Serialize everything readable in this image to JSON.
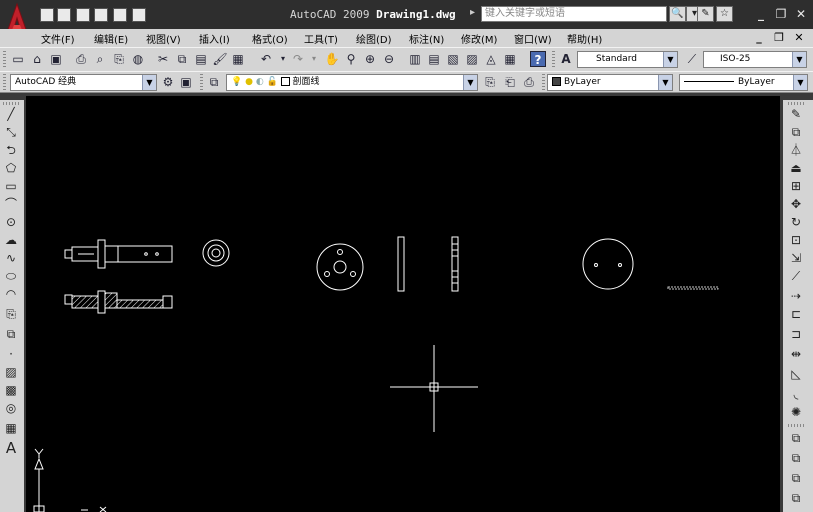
{
  "titlebar": {
    "app_name": "AutoCAD 2009",
    "file_name": "Drawing1.dwg",
    "search_placeholder": "键入关键字或短语",
    "search_arrow": "▸",
    "minimize": "_",
    "restore": "❐",
    "close": "✕"
  },
  "menubar": {
    "items": [
      "文件(F)",
      "编辑(E)",
      "视图(V)",
      "插入(I)",
      "格式(O)",
      "工具(T)",
      "绘图(D)",
      "标注(N)",
      "修改(M)",
      "窗口(W)",
      "帮助(H)"
    ],
    "doc_minimize": "_",
    "doc_restore": "❐",
    "doc_close": "✕"
  },
  "toolbar1": {
    "text_style": "Standard",
    "dim_style": "ISO-25"
  },
  "toolbar2": {
    "workspace": "AutoCAD 经典",
    "layer": "剖面线",
    "color": "ByLayer",
    "linetype": "ByLayer"
  },
  "ucs": {
    "y_label": "Y",
    "x_label": "X"
  },
  "colors": {
    "canvas": "#000000",
    "toolbar": "#d4d4d4",
    "titlebar": "#2e2e2e",
    "logo": "#c0202a",
    "drawing_lines": "#ffffff",
    "dashed_line": "#c8c8c8"
  }
}
